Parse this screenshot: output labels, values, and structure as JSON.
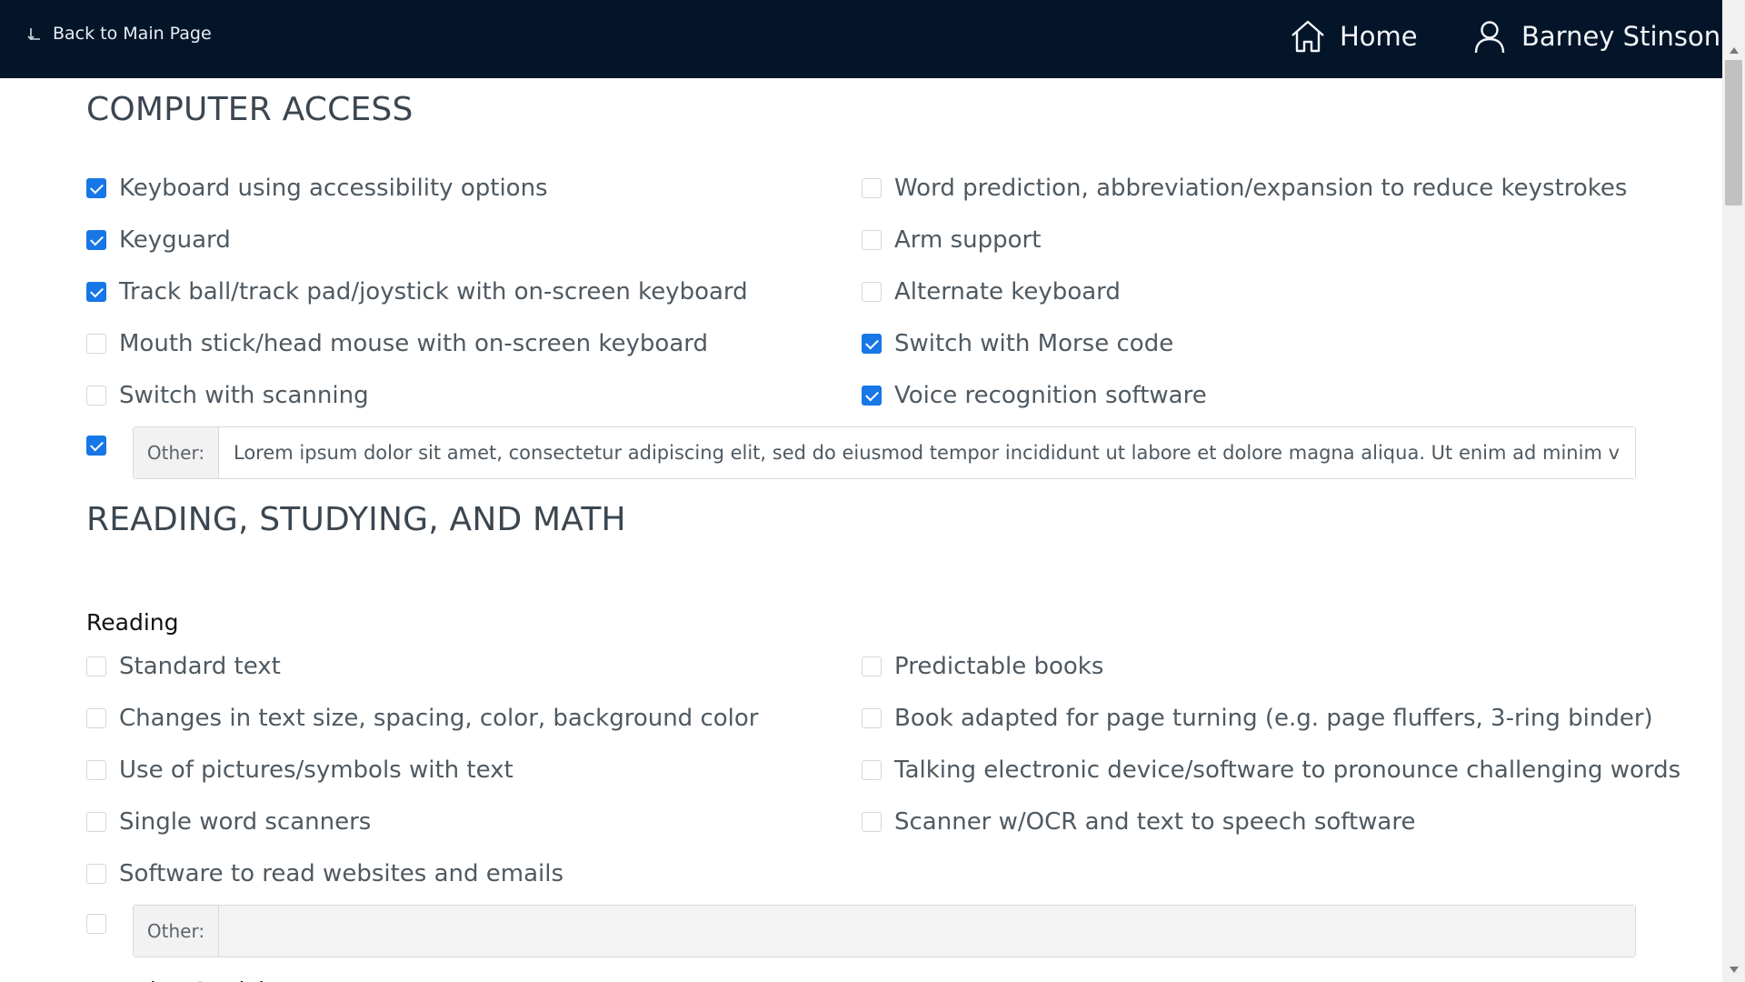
{
  "topbar": {
    "back_label": "Back to Main Page",
    "home_label": "Home",
    "user_name": "Barney Stinson"
  },
  "computer_access": {
    "title": "COMPUTER ACCESS",
    "left": [
      {
        "label": "Keyboard using accessibility options",
        "checked": true
      },
      {
        "label": "Keyguard",
        "checked": true
      },
      {
        "label": "Track ball/track pad/joystick with on-screen keyboard",
        "checked": true
      },
      {
        "label": "Mouth stick/head mouse with on-screen keyboard",
        "checked": false
      },
      {
        "label": "Switch with scanning",
        "checked": false
      }
    ],
    "right": [
      {
        "label": "Word prediction, abbreviation/expansion to reduce keystrokes",
        "checked": false
      },
      {
        "label": "Arm support",
        "checked": false
      },
      {
        "label": "Alternate keyboard",
        "checked": false
      },
      {
        "label": "Switch with Morse code",
        "checked": true
      },
      {
        "label": "Voice recognition software",
        "checked": true
      }
    ],
    "other": {
      "checked": true,
      "label": "Other:",
      "value": "Lorem ipsum dolor sit amet, consectetur adipiscing elit, sed do eiusmod tempor incididunt ut labore et dolore magna aliqua. Ut enim ad minim veniam"
    }
  },
  "reading_section": {
    "title": "READING, STUDYING, AND MATH",
    "reading": {
      "title": "Reading",
      "left": [
        {
          "label": "Standard text",
          "checked": false
        },
        {
          "label": "Changes in text size, spacing, color, background color",
          "checked": false
        },
        {
          "label": "Use of pictures/symbols with text",
          "checked": false
        },
        {
          "label": "Single word scanners",
          "checked": false
        },
        {
          "label": "Software to read websites and emails",
          "checked": false
        }
      ],
      "right": [
        {
          "label": "Predictable books",
          "checked": false
        },
        {
          "label": "Book adapted for page turning (e.g. page fluffers, 3-ring binder)",
          "checked": false
        },
        {
          "label": "Talking electronic device/software to pronounce challenging words",
          "checked": false
        },
        {
          "label": "Scanner w/OCR and text to speech software",
          "checked": false
        }
      ],
      "other": {
        "checked": false,
        "label": "Other:",
        "value": ""
      }
    },
    "next_subtitle": "Learning/Studying"
  }
}
